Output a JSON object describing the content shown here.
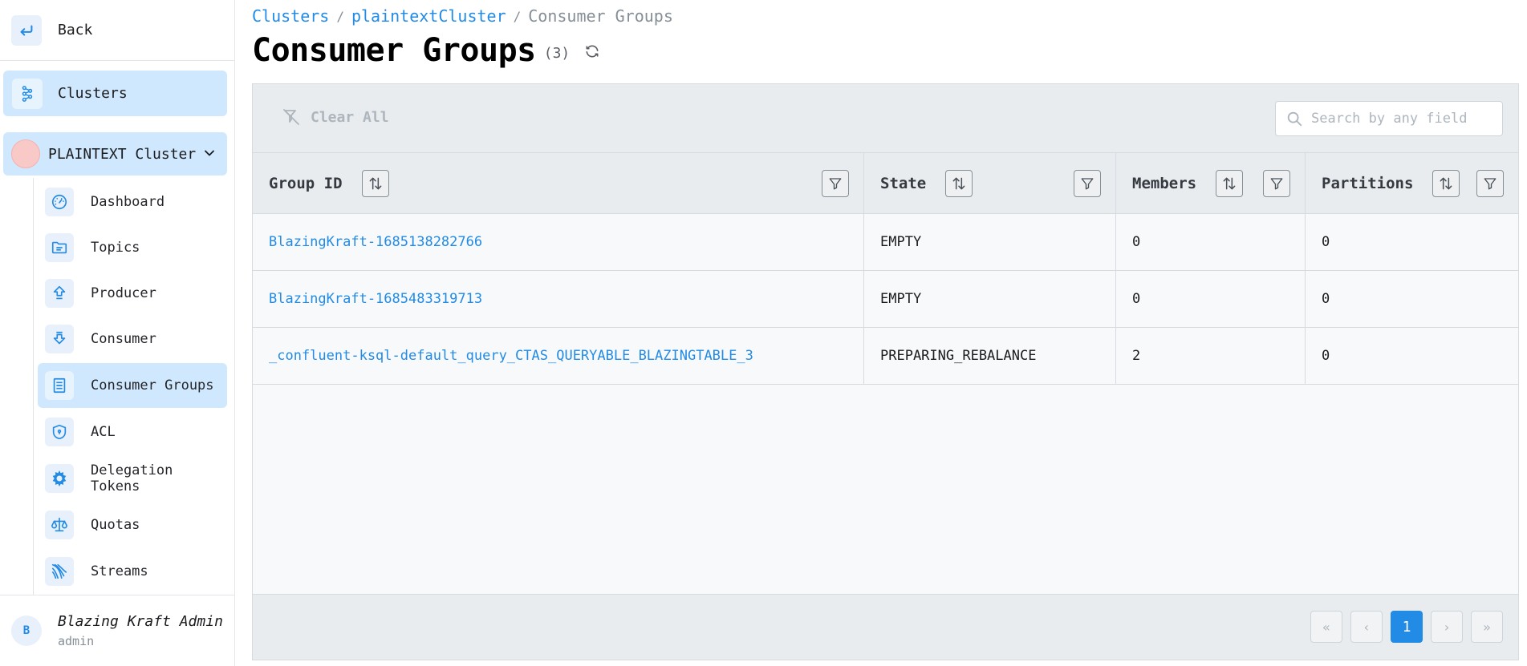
{
  "sidebar": {
    "back_label": "Back",
    "clusters_label": "Clusters",
    "cluster_name": "PLAINTEXT Cluster",
    "items": [
      {
        "label": "Dashboard",
        "icon": "dashboard-icon"
      },
      {
        "label": "Topics",
        "icon": "topics-icon"
      },
      {
        "label": "Producer",
        "icon": "producer-icon"
      },
      {
        "label": "Consumer",
        "icon": "consumer-icon"
      },
      {
        "label": "Consumer Groups",
        "icon": "consumer-groups-icon"
      },
      {
        "label": "ACL",
        "icon": "shield-icon"
      },
      {
        "label": "Delegation Tokens",
        "icon": "token-icon"
      },
      {
        "label": "Quotas",
        "icon": "scale-icon"
      },
      {
        "label": "Streams",
        "icon": "streams-icon"
      }
    ],
    "active_item": "Consumer Groups",
    "user": {
      "initial": "B",
      "name": "Blazing Kraft Admin",
      "role": "admin"
    }
  },
  "breadcrumb": {
    "root": "Clusters",
    "cluster": "plaintextCluster",
    "current": "Consumer Groups"
  },
  "page": {
    "title": "Consumer Groups",
    "count": "(3)"
  },
  "toolbar": {
    "clear_label": "Clear All",
    "search_placeholder": "Search by any field"
  },
  "table": {
    "columns": [
      "Group ID",
      "State",
      "Members",
      "Partitions"
    ],
    "rows": [
      [
        "BlazingKraft-1685138282766",
        "EMPTY",
        "0",
        "0"
      ],
      [
        "BlazingKraft-1685483319713",
        "EMPTY",
        "0",
        "0"
      ],
      [
        "_confluent-ksql-default_query_CTAS_QUERYABLE_BLAZINGTABLE_3",
        "PREPARING_REBALANCE",
        "2",
        "0"
      ]
    ]
  },
  "pagination": {
    "first": "«",
    "prev": "‹",
    "current": "1",
    "next": "›",
    "last": "»"
  },
  "colors": {
    "accent": "#228be6",
    "active_bg": "#d0e8fd",
    "panel_bg": "#e9ecef"
  }
}
